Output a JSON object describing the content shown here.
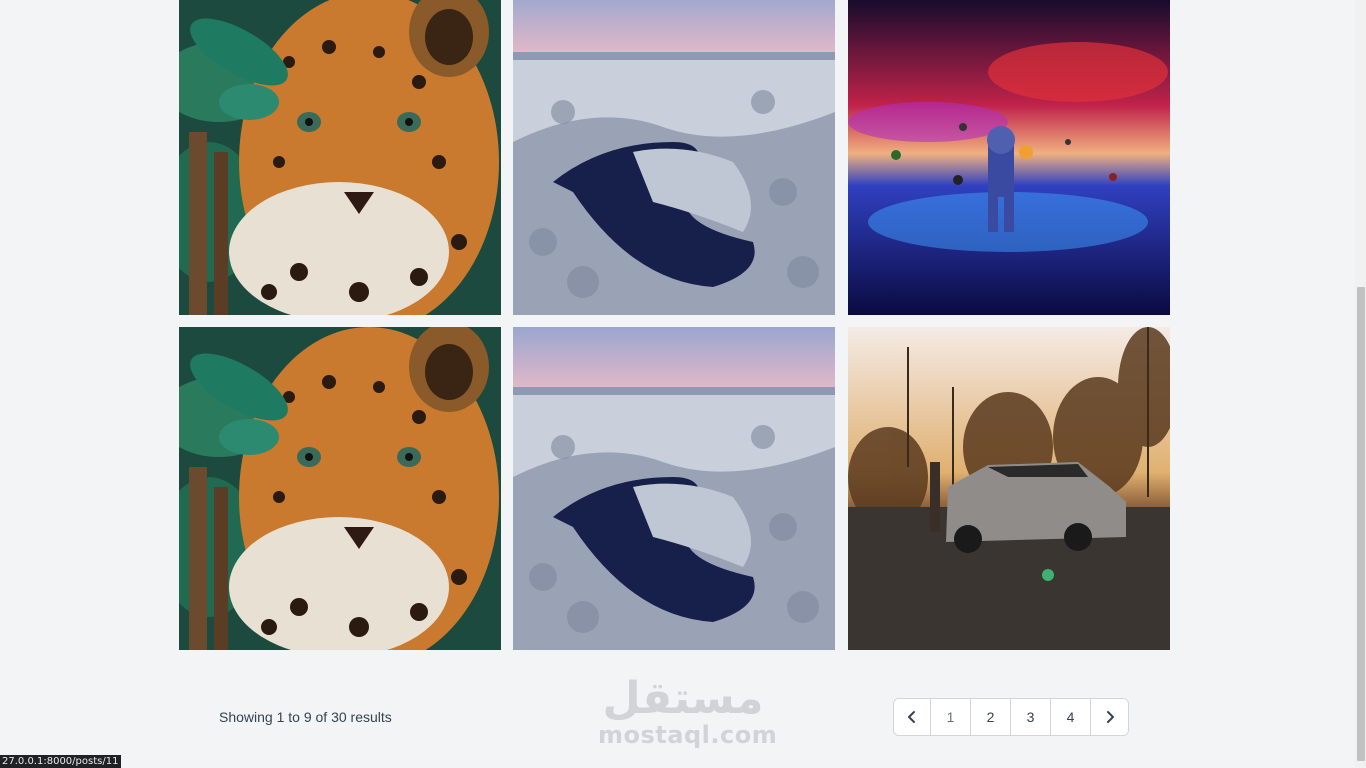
{
  "gallery": {
    "items": [
      {
        "subject": "jaguar-in-jungle",
        "alt": "Jaguar"
      },
      {
        "subject": "snowy-forest-lake",
        "alt": "Winter lake"
      },
      {
        "subject": "astronaut-in-space",
        "alt": "Astronaut"
      },
      {
        "subject": "jaguar-in-jungle",
        "alt": "Jaguar"
      },
      {
        "subject": "snowy-forest-lake",
        "alt": "Winter lake"
      },
      {
        "subject": "car-at-sunset",
        "alt": "Car"
      }
    ]
  },
  "pagination": {
    "summary": "Showing 1 to 9 of 30 results",
    "prev_icon": "chevron-left-icon",
    "next_icon": "chevron-right-icon",
    "pages": [
      "1",
      "2",
      "3",
      "4"
    ],
    "current_page": "1"
  },
  "watermark": {
    "arabic": "مستقل",
    "latin": "mostaql.com"
  },
  "status_bar": {
    "url": "27.0.0.1:8000/posts/11"
  },
  "colors": {
    "background": "#f3f4f6",
    "border": "#d1d5db",
    "text": "#374151"
  }
}
